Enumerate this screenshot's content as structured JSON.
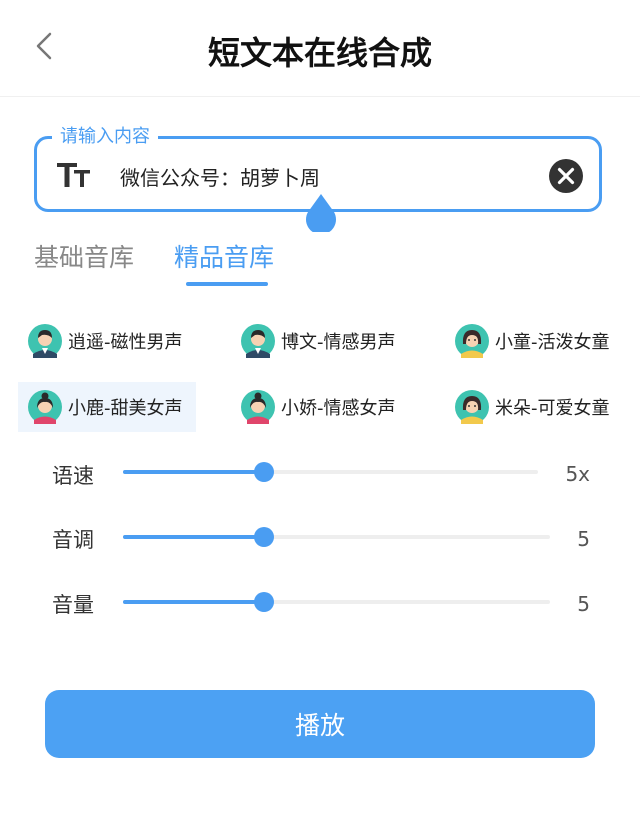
{
  "header": {
    "title": "短文本在线合成"
  },
  "input": {
    "legend": "请输入内容",
    "value": "微信公众号：胡萝卜周"
  },
  "tabs": [
    {
      "label": "基础音库",
      "active": false
    },
    {
      "label": "精品音库",
      "active": true
    }
  ],
  "voices": [
    {
      "label": "逍遥-磁性男声",
      "gender": "male",
      "selected": false
    },
    {
      "label": "博文-情感男声",
      "gender": "male",
      "selected": false
    },
    {
      "label": "小童-活泼女童",
      "gender": "girl",
      "selected": false
    },
    {
      "label": "小鹿-甜美女声",
      "gender": "female",
      "selected": true
    },
    {
      "label": "小娇-情感女声",
      "gender": "female",
      "selected": false
    },
    {
      "label": "米朵-可爱女童",
      "gender": "girl",
      "selected": false
    }
  ],
  "sliders": {
    "speed": {
      "label": "语速",
      "value": "5x",
      "fraction": 0.34
    },
    "pitch": {
      "label": "音调",
      "value": "5",
      "fraction": 0.33
    },
    "volume": {
      "label": "音量",
      "value": "5",
      "fraction": 0.33
    }
  },
  "play_button": {
    "label": "播放"
  },
  "colors": {
    "accent": "#4a9df2",
    "button": "#4ca1f3",
    "selected_bg": "#eef5fd"
  }
}
